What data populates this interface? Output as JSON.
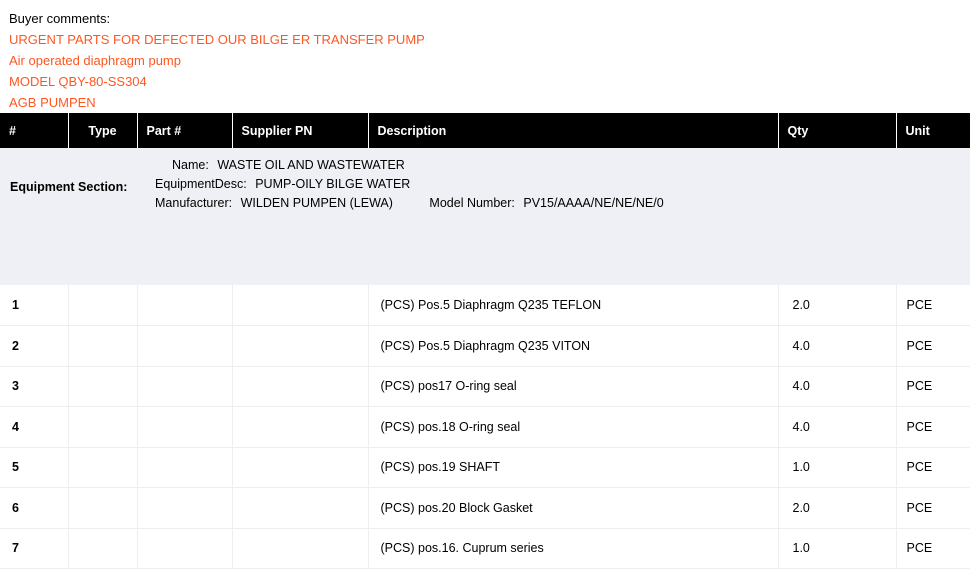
{
  "comments": {
    "label": "Buyer comments:",
    "accent_color": "#ff5722",
    "lines": [
      "URGENT PARTS FOR DEFECTED OUR BILGE ER TRANSFER PUMP",
      "Air operated diaphragm pump",
      "MODEL QBY-80-SS304",
      "AGB PUMPEN"
    ]
  },
  "table": {
    "header_background": "#000000",
    "header_text_color": "#ffffff",
    "columns": [
      {
        "key": "num",
        "label": "#",
        "align": "left"
      },
      {
        "key": "type",
        "label": "Type",
        "align": "center"
      },
      {
        "key": "part",
        "label": "Part #",
        "align": "left"
      },
      {
        "key": "supplier",
        "label": "Supplier PN",
        "align": "left"
      },
      {
        "key": "desc",
        "label": "Description",
        "align": "left"
      },
      {
        "key": "qty",
        "label": "Qty",
        "align": "left"
      },
      {
        "key": "unit",
        "label": "Unit",
        "align": "left"
      }
    ],
    "equipment_section": {
      "background": "#eef0f5",
      "label": "Equipment Section:",
      "name_key": "Name:",
      "name_value": "WASTE OIL AND WASTEWATER",
      "desc_key": "EquipmentDesc:",
      "desc_value": "PUMP-OILY BILGE WATER",
      "manufacturer_key": "Manufacturer:",
      "manufacturer_value": "WILDEN PUMPEN (LEWA)",
      "model_key": "Model Number:",
      "model_value": "PV15/AAAA/NE/NE/NE/0"
    },
    "rows": [
      {
        "num": "1",
        "type": "",
        "part": "",
        "supplier": "",
        "desc": "(PCS) Pos.5 Diaphragm Q235 TEFLON",
        "qty": "2.0",
        "unit": "PCE"
      },
      {
        "num": "2",
        "type": "",
        "part": "",
        "supplier": "",
        "desc": "(PCS) Pos.5 Diaphragm Q235 VITON",
        "qty": "4.0",
        "unit": "PCE"
      },
      {
        "num": "3",
        "type": "",
        "part": "",
        "supplier": "",
        "desc": "(PCS) pos17 O-ring seal",
        "qty": "4.0",
        "unit": "PCE"
      },
      {
        "num": "4",
        "type": "",
        "part": "",
        "supplier": "",
        "desc": "(PCS) pos.18 O-ring seal",
        "qty": "4.0",
        "unit": "PCE"
      },
      {
        "num": "5",
        "type": "",
        "part": "",
        "supplier": "",
        "desc": "(PCS) pos.19 SHAFT",
        "qty": "1.0",
        "unit": "PCE"
      },
      {
        "num": "6",
        "type": "",
        "part": "",
        "supplier": "",
        "desc": "(PCS) pos.20 Block Gasket",
        "qty": "2.0",
        "unit": "PCE"
      },
      {
        "num": "7",
        "type": "",
        "part": "",
        "supplier": "",
        "desc": "(PCS) pos.16. Cuprum series",
        "qty": "1.0",
        "unit": "PCE"
      }
    ]
  }
}
